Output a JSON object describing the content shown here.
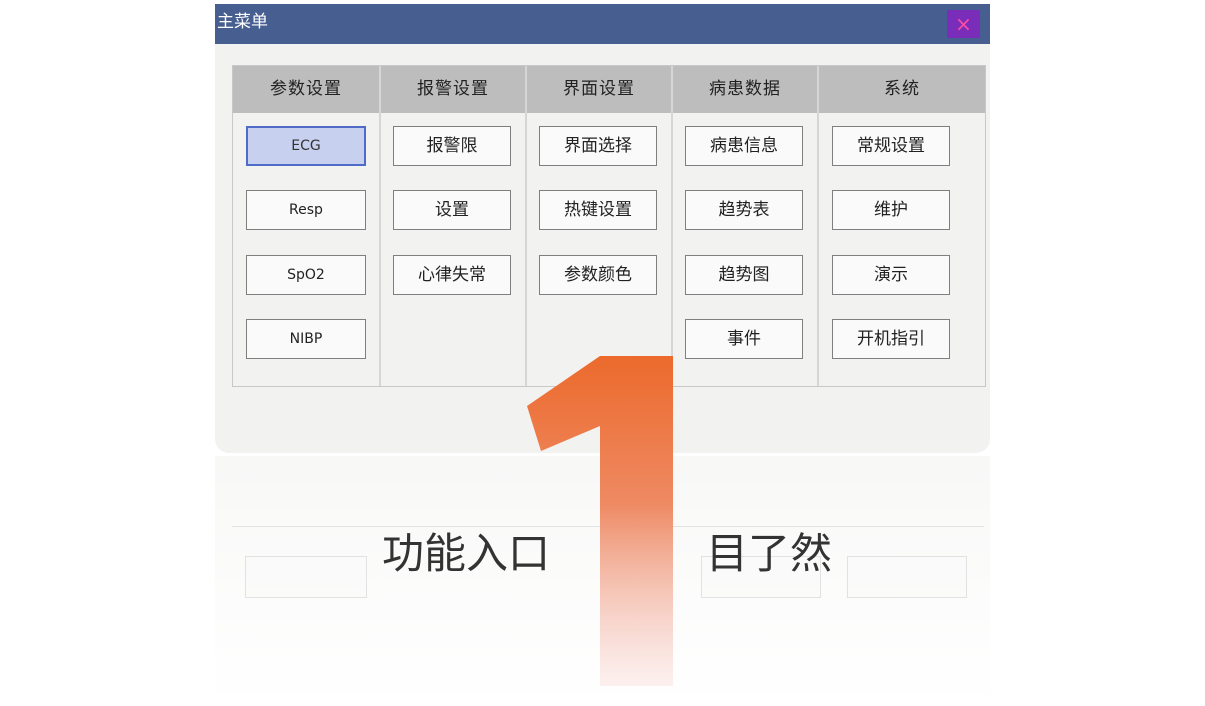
{
  "window": {
    "title": "主菜单",
    "close_symbol": "×"
  },
  "columns": [
    {
      "header": "参数设置",
      "items": [
        "ECG",
        "Resp",
        "SpO2",
        "NIBP"
      ]
    },
    {
      "header": "报警设置",
      "items": [
        "报警限",
        "设置",
        "心律失常"
      ]
    },
    {
      "header": "界面设置",
      "items": [
        "界面选择",
        "热键设置",
        "参数颜色"
      ]
    },
    {
      "header": "病患数据",
      "items": [
        "病患信息",
        "趋势表",
        "趋势图",
        "事件"
      ]
    },
    {
      "header": "系统",
      "items": [
        "常规设置",
        "维护",
        "演示",
        "开机指引"
      ]
    }
  ],
  "selected_item": "ECG",
  "tagline": {
    "left": "功能入口",
    "right": "目了然"
  },
  "colors": {
    "titlebar": "#465e90",
    "close_bg": "#7a2db8",
    "accent": "#ec6a2c",
    "selected_bg": "#c7d0ee"
  }
}
